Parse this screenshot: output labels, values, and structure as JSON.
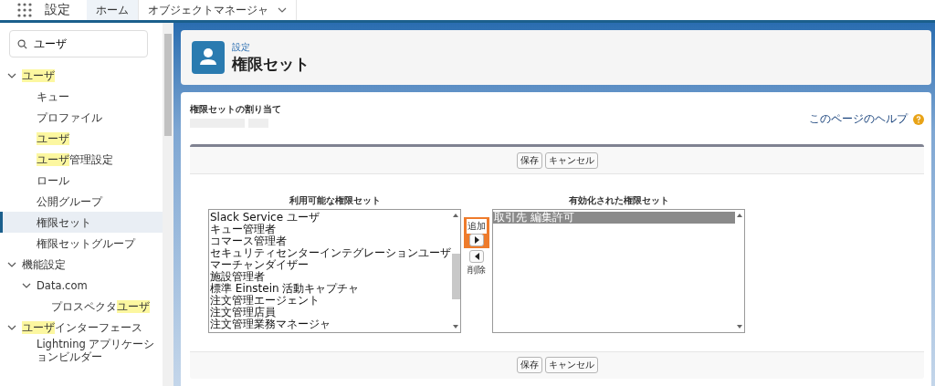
{
  "top_bar": {
    "app_title": "設定",
    "tabs": [
      {
        "label": "ホーム",
        "selected": true,
        "dropdown": false
      },
      {
        "label": "オブジェクトマネージャ",
        "selected": false,
        "dropdown": true
      }
    ]
  },
  "sidebar": {
    "search": {
      "value": "ユーザ"
    },
    "items": [
      {
        "parts": [
          {
            "text": "ユーザ",
            "highlight": true
          }
        ],
        "selected": false,
        "expanded": true,
        "children": [
          {
            "parts": [
              {
                "text": "キュー",
                "highlight": false
              }
            ],
            "selected": false
          },
          {
            "parts": [
              {
                "text": "プロファイル",
                "highlight": false
              }
            ],
            "selected": false
          },
          {
            "parts": [
              {
                "text": "ユーザ",
                "highlight": true
              }
            ],
            "selected": false
          },
          {
            "parts": [
              {
                "text": "ユーザ",
                "highlight": true
              },
              {
                "text": "管理設定",
                "highlight": false
              }
            ],
            "selected": false
          },
          {
            "parts": [
              {
                "text": "ロール",
                "highlight": false
              }
            ],
            "selected": false
          },
          {
            "parts": [
              {
                "text": "公開グループ",
                "highlight": false
              }
            ],
            "selected": false
          },
          {
            "parts": [
              {
                "text": "権限セット",
                "highlight": false
              }
            ],
            "selected": true
          },
          {
            "parts": [
              {
                "text": "権限セットグループ",
                "highlight": false
              }
            ],
            "selected": false
          }
        ]
      },
      {
        "parts": [
          {
            "text": "機能設定",
            "highlight": false
          }
        ],
        "selected": false,
        "expanded": true,
        "children": [
          {
            "parts": [
              {
                "text": "Data.com",
                "highlight": false
              }
            ],
            "selected": false,
            "expanded": true,
            "children": [
              {
                "parts": [
                  {
                    "text": "プロスペクタ",
                    "highlight": false
                  },
                  {
                    "text": "ユーザ",
                    "highlight": true
                  }
                ],
                "selected": false
              }
            ]
          }
        ]
      },
      {
        "parts": [
          {
            "text": "ユーザ",
            "highlight": true
          },
          {
            "text": "インターフェース",
            "highlight": false
          }
        ],
        "selected": false,
        "expanded": true,
        "children": [
          {
            "parts": [
              {
                "text": "Lightning アプリケーションビルダー",
                "highlight": false
              }
            ],
            "selected": false
          }
        ]
      }
    ]
  },
  "header": {
    "breadcrumb": "設定",
    "title": "権限セット"
  },
  "content": {
    "section_label": "権限セットの割り当て",
    "help_link": "このページのヘルプ",
    "top_buttons": [
      "保存",
      "キャンセル"
    ],
    "bottom_buttons": [
      "保存",
      "キャンセル"
    ],
    "available": {
      "heading": "利用可能な権限セット",
      "items": [
        {
          "label": "Slack Service ユーザ",
          "selected": false
        },
        {
          "label": "キュー管理者",
          "selected": false
        },
        {
          "label": "コマース管理者",
          "selected": false
        },
        {
          "label": "セキュリティセンターインテグレーションユーザ",
          "selected": false
        },
        {
          "label": "マーチャンダイザー",
          "selected": false
        },
        {
          "label": "施設管理者",
          "selected": false
        },
        {
          "label": "標準 Einstein 活動キャプチャ",
          "selected": false
        },
        {
          "label": "注文管理エージェント",
          "selected": false
        },
        {
          "label": "注文管理店員",
          "selected": false
        },
        {
          "label": "注文管理業務マネージャ",
          "selected": false
        }
      ]
    },
    "add_button": {
      "label": "追加",
      "highlighted": true
    },
    "remove_button": {
      "label": "削除"
    },
    "enabled": {
      "heading": "有効化された権限セット",
      "items": [
        {
          "label": "取引先 編集許可",
          "selected": true
        }
      ]
    }
  }
}
